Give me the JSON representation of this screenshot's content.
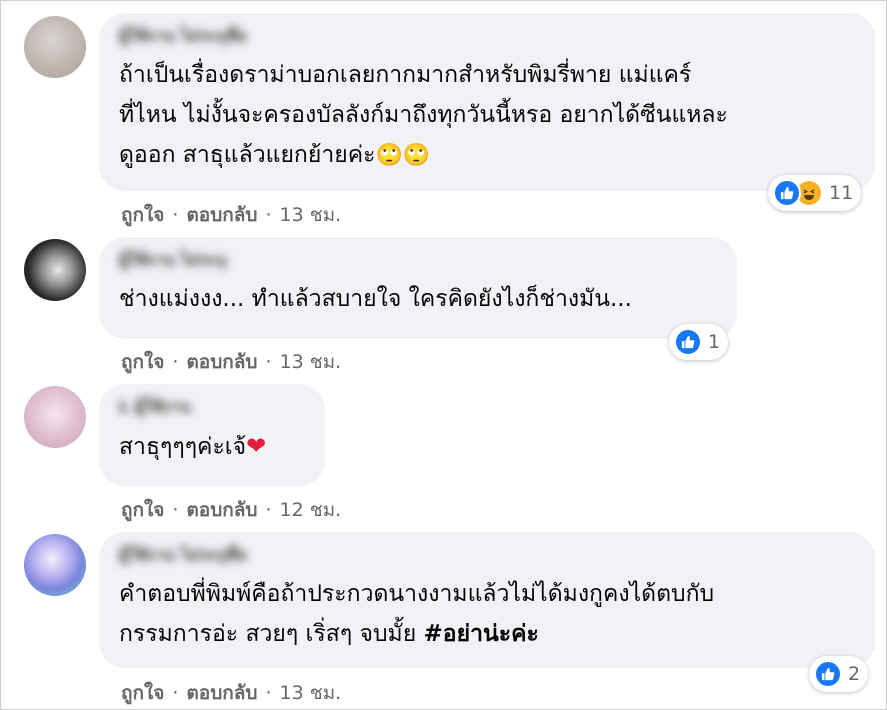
{
  "comments": [
    {
      "name": "ผู้ใช้งาน ไม่ระบุชื่อ",
      "lines": [
        "ถ้าเป็นเรื่องดราม่าบอกเลยกากมากสำหรับพิมรี่พาย แม่แคร์",
        "ที่ไหน ไม่งั้นจะครองบัลลังก์มาถึงทุกวันนี้หรอ อยากได้ซีนแหละ",
        "ดูออก สาธุแล้วแยกย้ายค่ะ"
      ],
      "emojis": [
        "🙄",
        "🙄"
      ],
      "like": "ถูกใจ",
      "reply": "ตอบกลับ",
      "time": "13 ชม.",
      "reaction_count": "11",
      "reactions": [
        "like-icon",
        "haha-icon"
      ]
    },
    {
      "name": "ผู้ใช้งาน ไม่ระบุ",
      "lines": [
        "ช่างแม่งงง... ทำแล้วสบายใจ ใครคิดยังไงก็ช่างมัน..."
      ],
      "like": "ถูกใจ",
      "reply": "ตอบกลับ",
      "time": "13 ชม.",
      "reaction_count": "1",
      "reactions": [
        "like-icon"
      ]
    },
    {
      "name": "L ผู้ใช้งาน",
      "lines": [
        "สาธุๆๆๆค่ะเจ้"
      ],
      "emojis": [
        "❤"
      ],
      "like": "ถูกใจ",
      "reply": "ตอบกลับ",
      "time": "12 ชม."
    },
    {
      "name": "ผู้ใช้งาน ไม่ระบุชื่อ",
      "lines": [
        "คำตอบพี่พิมพ์คือถ้าประกวดนางงามแล้วไม่ได้มงกูคงได้ตบกับ",
        "กรรมการอ่ะ สวยๆ เริ่สๆ จบมั้ย "
      ],
      "hashtag": "#อย่าน่ะค่ะ",
      "like": "ถูกใจ",
      "reply": "ตอบกลับ",
      "time": "13 ชม.",
      "reaction_count": "2",
      "reactions": [
        "like-icon"
      ]
    }
  ],
  "separator": "·",
  "colors": {
    "bubble": "#f0f2f5",
    "like_blue": "#1877f2",
    "haha_yellow": "#f7b125",
    "meta_gray": "#65676b",
    "heart_red": "#e41e3f"
  }
}
